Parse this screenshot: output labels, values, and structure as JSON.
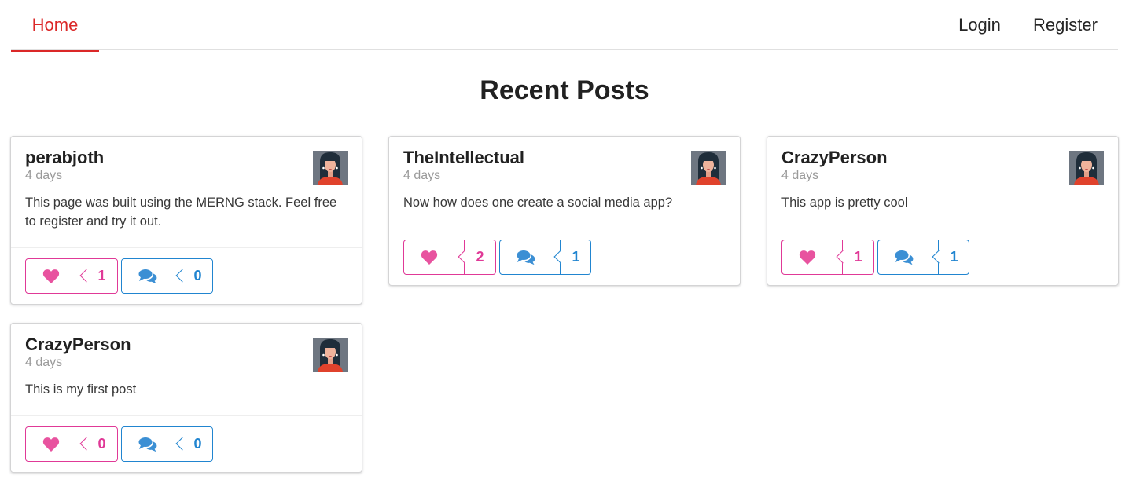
{
  "colors": {
    "accent_red": "#db2828",
    "like_pink": "#e03997",
    "comment_blue": "#2185d0",
    "heart_icon": "#e8539f",
    "comment_icon": "#3b8fd4"
  },
  "nav": {
    "home": "Home",
    "login": "Login",
    "register": "Register"
  },
  "page_title": "Recent Posts",
  "posts": [
    {
      "username": "perabjoth",
      "time": "4 days",
      "body": "This page was built using the MERNG stack. Feel free to register and try it out.",
      "likes": "1",
      "comments": "0",
      "avatar_icon": "user-avatar-icon"
    },
    {
      "username": "TheIntellectual",
      "time": "4 days",
      "body": "Now how does one create a social media app?",
      "likes": "2",
      "comments": "1",
      "avatar_icon": "user-avatar-icon"
    },
    {
      "username": "CrazyPerson",
      "time": "4 days",
      "body": "This app is pretty cool",
      "likes": "1",
      "comments": "1",
      "avatar_icon": "user-avatar-icon"
    },
    {
      "username": "CrazyPerson",
      "time": "4 days",
      "body": "This is my first post",
      "likes": "0",
      "comments": "0",
      "avatar_icon": "user-avatar-icon"
    }
  ],
  "icons": {
    "like": "heart-icon",
    "comment": "comments-icon"
  }
}
